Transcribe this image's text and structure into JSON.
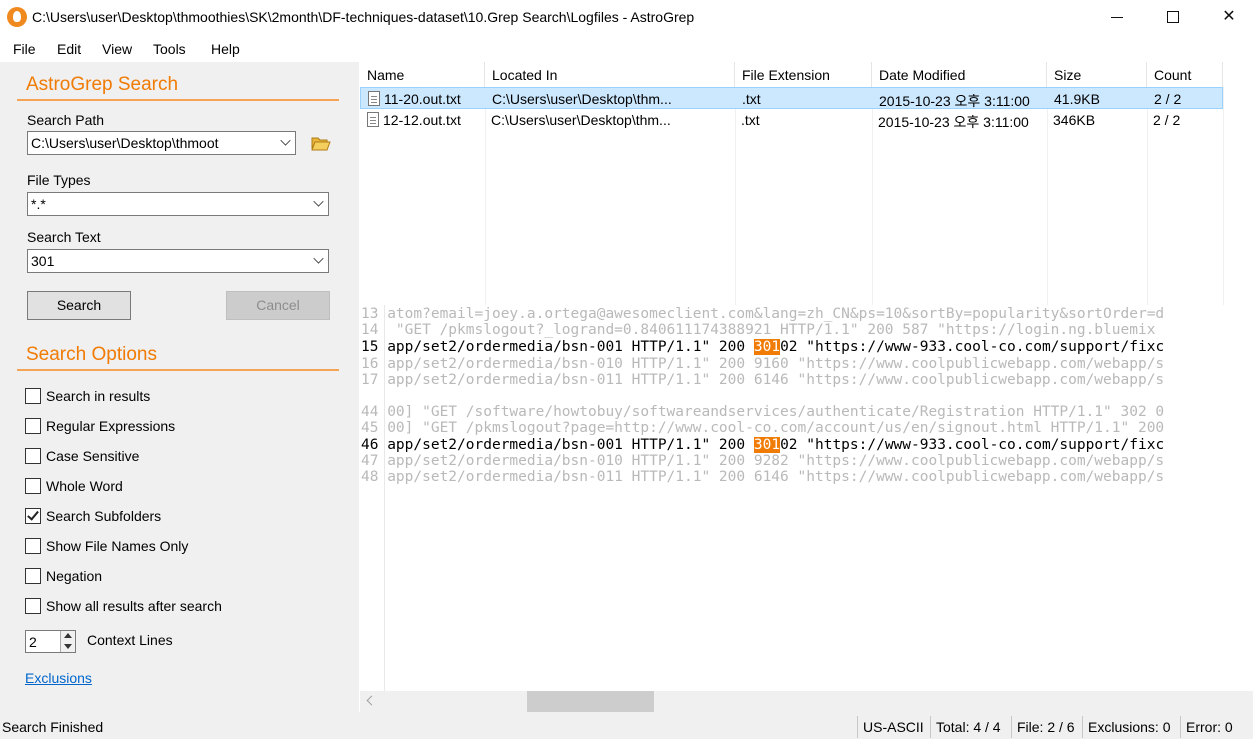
{
  "window": {
    "title": "C:\\Users\\user\\Desktop\\thmoothies\\SK\\2month\\DF-techniques-dataset\\10.Grep Search\\Logfiles - AstroGrep"
  },
  "menu": [
    "File",
    "Edit",
    "View",
    "Tools",
    "Help"
  ],
  "search": {
    "heading": "AstroGrep Search",
    "path_label": "Search Path",
    "path_value": "C:\\Users\\user\\Desktop\\thmoot",
    "types_label": "File Types",
    "types_value": "*.*",
    "text_label": "Search Text",
    "text_value": "301",
    "search_button": "Search",
    "cancel_button": "Cancel"
  },
  "options": {
    "heading": "Search Options",
    "items": [
      {
        "label": "Search in results",
        "checked": false
      },
      {
        "label": "Regular Expressions",
        "checked": false
      },
      {
        "label": "Case Sensitive",
        "checked": false
      },
      {
        "label": "Whole Word",
        "checked": false
      },
      {
        "label": "Search Subfolders",
        "checked": true
      },
      {
        "label": "Show File Names Only",
        "checked": false
      },
      {
        "label": "Negation",
        "checked": false
      },
      {
        "label": "Show all results after search",
        "checked": false
      }
    ],
    "context_lines_value": "2",
    "context_lines_label": "Context Lines",
    "exclusions_link": "Exclusions"
  },
  "results": {
    "columns": [
      "Name",
      "Located In",
      "File Extension",
      "Date Modified",
      "Size",
      "Count"
    ],
    "rows": [
      {
        "name": "11-20.out.txt",
        "location": "C:\\Users\\user\\Desktop\\thm...",
        "ext": ".txt",
        "modified": "2015-10-23 오후 3:11:00",
        "size": "41.9KB",
        "count": "2 / 2",
        "selected": true
      },
      {
        "name": "12-12.out.txt",
        "location": "C:\\Users\\user\\Desktop\\thm...",
        "ext": ".txt",
        "modified": "2015-10-23 오후 3:11:00",
        "size": "346KB",
        "count": "2 / 2",
        "selected": false
      }
    ]
  },
  "preview": {
    "lines": [
      {
        "num": "13",
        "text": "atom?email=joey.a.ortega@awesomeclient.com&lang=zh_CN&ps=10&sortBy=popularity&sortOrder=d",
        "match": false
      },
      {
        "num": "14",
        "text": " \"GET /pkmslogout?_logrand=0.840611174388921 HTTP/1.1\" 200 587 \"https://login.ng.bluemix",
        "match": false
      },
      {
        "num": "15",
        "text_before": "app/set2/ordermedia/bsn-001 HTTP/1.1\" 200 ",
        "hit": "301",
        "text_after": "02 \"https://www-933.cool-co.com/support/fixc",
        "match": true
      },
      {
        "num": "16",
        "text": "app/set2/ordermedia/bsn-010 HTTP/1.1\" 200 9160 \"https://www.coolpublicwebapp.com/webapp/s",
        "match": false
      },
      {
        "num": "17",
        "text": "app/set2/ordermedia/bsn-011 HTTP/1.1\" 200 6146 \"https://www.coolpublicwebapp.com/webapp/s",
        "match": false
      },
      {
        "num": "44",
        "text": "00] \"GET /software/howtobuy/softwareandservices/authenticate/Registration HTTP/1.1\" 302 0",
        "match": false
      },
      {
        "num": "45",
        "text": "00] \"GET /pkmslogout?page=http://www.cool-co.com/account/us/en/signout.html HTTP/1.1\" 200",
        "match": false
      },
      {
        "num": "46",
        "text_before": "app/set2/ordermedia/bsn-001 HTTP/1.1\" 200 ",
        "hit": "301",
        "text_after": "02 \"https://www-933.cool-co.com/support/fixc",
        "match": true
      },
      {
        "num": "47",
        "text": "app/set2/ordermedia/bsn-010 HTTP/1.1\" 200 9282 \"https://www.coolpublicwebapp.com/webapp/s",
        "match": false
      },
      {
        "num": "48",
        "text": "app/set2/ordermedia/bsn-011 HTTP/1.1\" 200 6146 \"https://www.coolpublicwebapp.com/webapp/s",
        "match": false
      }
    ]
  },
  "status": {
    "main": "Search Finished",
    "encoding": "US-ASCII",
    "total": "Total: 4 / 4",
    "file": "File: 2 / 6",
    "exclusions": "Exclusions: 0",
    "error": "Error: 0"
  },
  "colors": {
    "accent": "#f07b05",
    "selection": "#cce8ff",
    "link": "#0066cc"
  }
}
